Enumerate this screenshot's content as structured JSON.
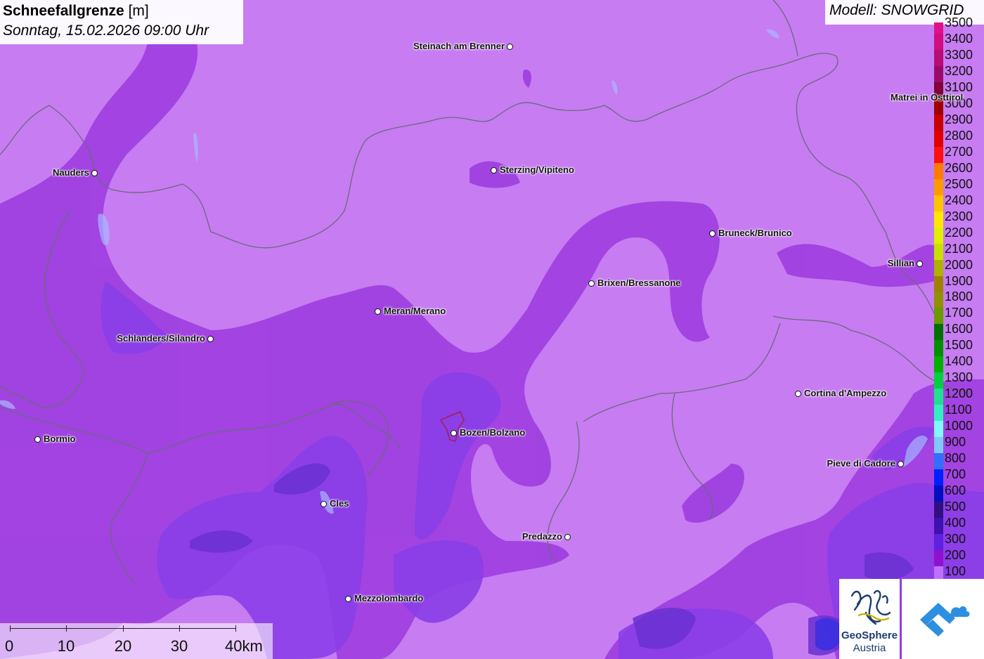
{
  "header": {
    "title_main": "Schneefallgrenze",
    "title_unit": "[m]",
    "subtitle": "Sonntag, 15.02.2026 09:00 Uhr"
  },
  "model": {
    "label": "Modell: SNOWGRID"
  },
  "legend": {
    "levels": [
      {
        "label": "3500",
        "color": "#e0108a"
      },
      {
        "label": "3400",
        "color": "#d00e80"
      },
      {
        "label": "3300",
        "color": "#b90c74"
      },
      {
        "label": "3200",
        "color": "#9c0a68"
      },
      {
        "label": "3100",
        "color": "#80003a"
      },
      {
        "label": "3000",
        "color": "#a00000"
      },
      {
        "label": "2900",
        "color": "#c80000"
      },
      {
        "label": "2800",
        "color": "#e00000"
      },
      {
        "label": "2700",
        "color": "#ff1010"
      },
      {
        "label": "2600",
        "color": "#ff7a00"
      },
      {
        "label": "2500",
        "color": "#ff9a00"
      },
      {
        "label": "2400",
        "color": "#ffc400"
      },
      {
        "label": "2300",
        "color": "#ffe600"
      },
      {
        "label": "2200",
        "color": "#e0f000"
      },
      {
        "label": "2100",
        "color": "#c8e000"
      },
      {
        "label": "2000",
        "color": "#b0b000"
      },
      {
        "label": "1900",
        "color": "#a08000"
      },
      {
        "label": "1800",
        "color": "#909000"
      },
      {
        "label": "1700",
        "color": "#6a9a00"
      },
      {
        "label": "1600",
        "color": "#007000"
      },
      {
        "label": "1500",
        "color": "#009000"
      },
      {
        "label": "1400",
        "color": "#00b000"
      },
      {
        "label": "1300",
        "color": "#00d040"
      },
      {
        "label": "1200",
        "color": "#20e090"
      },
      {
        "label": "1100",
        "color": "#30f0c0"
      },
      {
        "label": "1000",
        "color": "#80f8ff"
      },
      {
        "label": "900",
        "color": "#80c8ff"
      },
      {
        "label": "800",
        "color": "#3070ff"
      },
      {
        "label": "700",
        "color": "#0020ff"
      },
      {
        "label": "600",
        "color": "#0010c0"
      },
      {
        "label": "500",
        "color": "#301080"
      },
      {
        "label": "400",
        "color": "#4010b0"
      },
      {
        "label": "300",
        "color": "#6020e0"
      },
      {
        "label": "200",
        "color": "#9010d0"
      },
      {
        "label": "100",
        "color": "#c070ff"
      }
    ]
  },
  "cities": [
    {
      "name": "Steinach am Brenner",
      "side": "left"
    },
    {
      "name": "Nauders",
      "side": "left"
    },
    {
      "name": "Sterzing/Vipiteno",
      "side": "right"
    },
    {
      "name": "Matrei in Osttirol",
      "side": "left"
    },
    {
      "name": "Bruneck/Brunico",
      "side": "right"
    },
    {
      "name": "Sillian",
      "side": "left"
    },
    {
      "name": "Brixen/Bressanone",
      "side": "right"
    },
    {
      "name": "Meran/Merano",
      "side": "right"
    },
    {
      "name": "Schlanders/Silandro",
      "side": "left"
    },
    {
      "name": "Cortina d'Ampezzo",
      "side": "right"
    },
    {
      "name": "Bormio",
      "side": "right"
    },
    {
      "name": "Bozen/Bolzano",
      "side": "right"
    },
    {
      "name": "Pieve di Cadore",
      "side": "left"
    },
    {
      "name": "Cles",
      "side": "right"
    },
    {
      "name": "Predazzo",
      "side": "left"
    },
    {
      "name": "Mezzolombardo",
      "side": "right"
    }
  ],
  "scale": {
    "labels": [
      "0",
      "10",
      "20",
      "30",
      "40km"
    ]
  },
  "logos": {
    "geosphere_line1": "GeoSphere",
    "geosphere_line2": "Austria"
  },
  "colors": {
    "snowline_base": "#c77cf2",
    "snowline_200": "#a040e0",
    "snowline_300": "#8a3ee8",
    "snowline_low": "#6a30d0",
    "border": "#6a6a7a",
    "lake": "#a8b8ff",
    "app_logo": "#2d8fe0"
  }
}
